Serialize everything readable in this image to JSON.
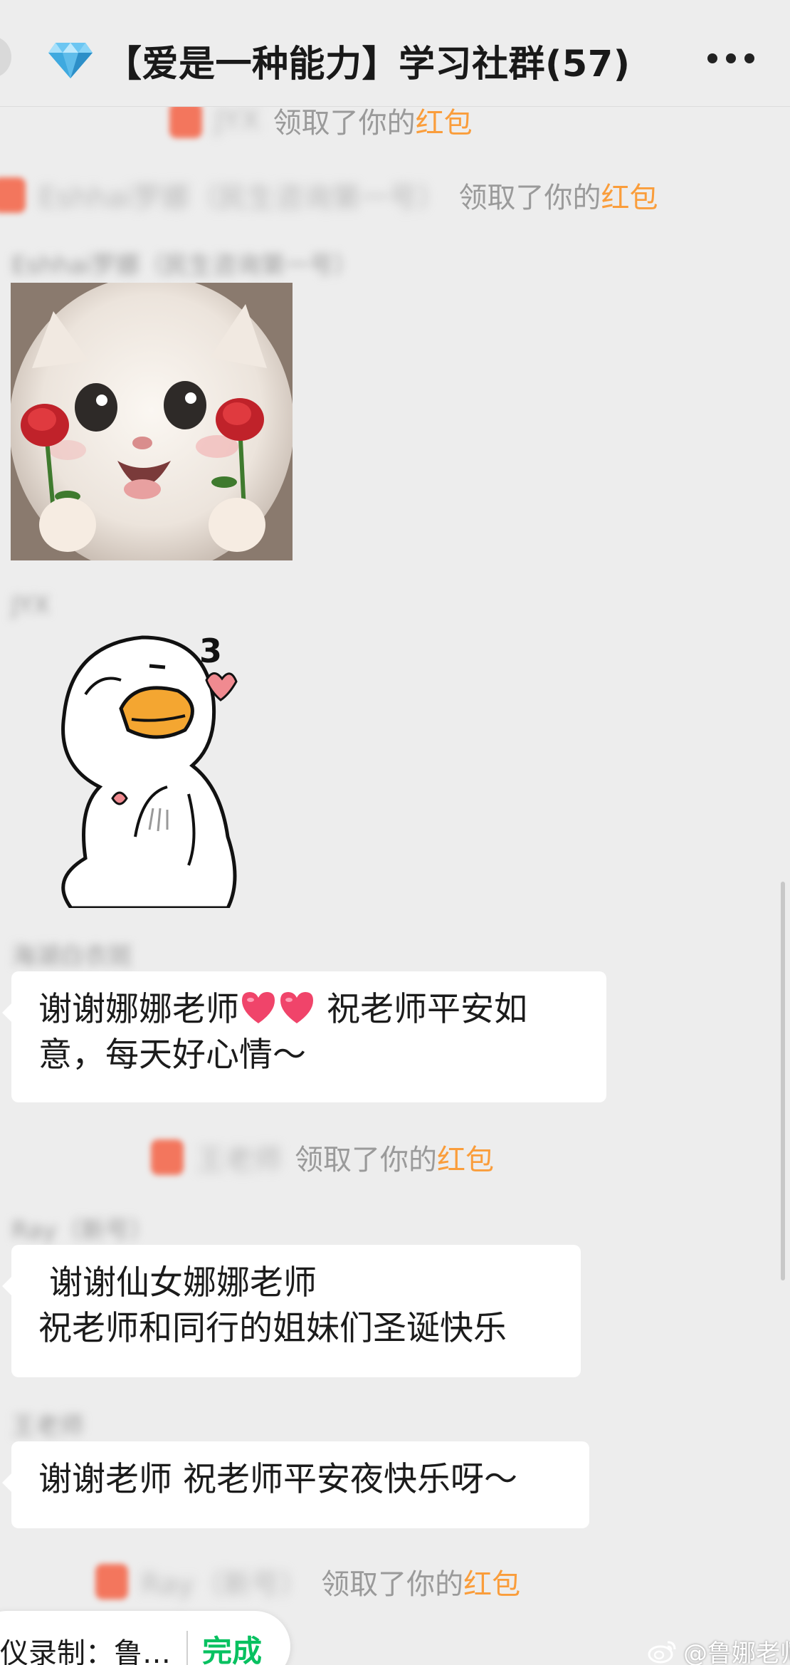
{
  "header": {
    "title": "【爱是一种能力】学习社群(57)"
  },
  "system_messages": [
    {
      "blurred_name": "JYX",
      "text": "领取了你的",
      "highlight": "红包"
    },
    {
      "blurred_name": "Eshhai罗娜（民生咨询第一号）",
      "text": "领取了你的",
      "highlight": "红包"
    },
    {
      "blurred_name": "王老师",
      "text": "领取了你的",
      "highlight": "红包"
    },
    {
      "blurred_name": "Ray（新号）",
      "text": "领取了你的",
      "highlight": "红包"
    }
  ],
  "senders": [
    "Eshhai罗娜（民生咨询第一号）",
    "JYX",
    "海湖白衣斑",
    "Ray（新号）",
    "王老师"
  ],
  "messages": [
    {
      "line1_before": "谢谢娜娜老师",
      "line1_after": " 祝老师平安如",
      "line2": "意，每天好心情～"
    },
    {
      "line1": " 谢谢仙女娜娜老师",
      "line2": "祝老师和同行的姐妹们圣诞快乐"
    },
    {
      "line1": "谢谢老师 祝老师平安夜快乐呀～"
    }
  ],
  "bottom_bar": {
    "recording_label": "仪录制：鲁…",
    "done_label": "完成",
    "watermark": "@鲁娜老师"
  },
  "colors": {
    "background": "#ededed",
    "bubble": "#ffffff",
    "highlight": "#fa9d3b",
    "done": "#07c160",
    "system_text": "#9a9a9a"
  },
  "icons": [
    "back-icon",
    "diamond-icon",
    "more-icon",
    "red-packet-icon",
    "heart-icon",
    "weibo-icon"
  ]
}
